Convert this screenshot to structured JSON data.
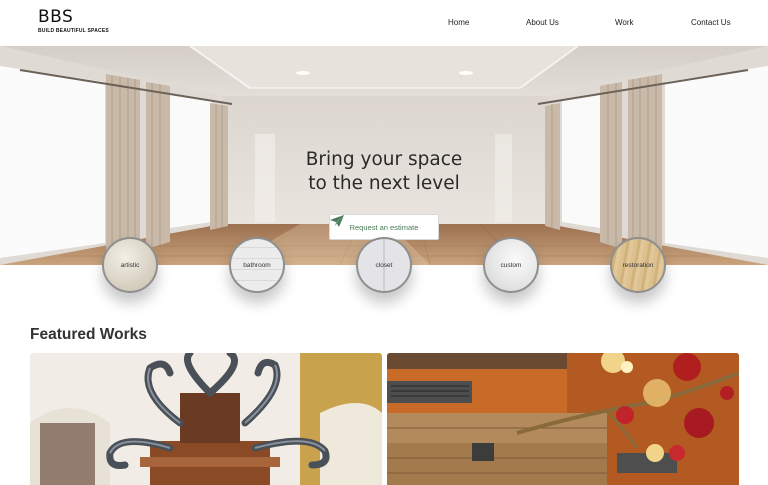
{
  "brand": {
    "name": "BBS",
    "tagline": "BUILD BEAUTIFUL SPACES"
  },
  "nav": {
    "items": [
      "Home",
      "About Us",
      "Work",
      "Contact Us"
    ]
  },
  "hero": {
    "title": "Bring your space\nto the next level",
    "cta_label": "Request an estimate",
    "cta_icon": "paper-plane-icon",
    "accent_color": "#4a7a58"
  },
  "categories": [
    "artistic",
    "bathroom",
    "closet",
    "custom",
    "restoration"
  ],
  "featured": {
    "title": "Featured Works"
  }
}
